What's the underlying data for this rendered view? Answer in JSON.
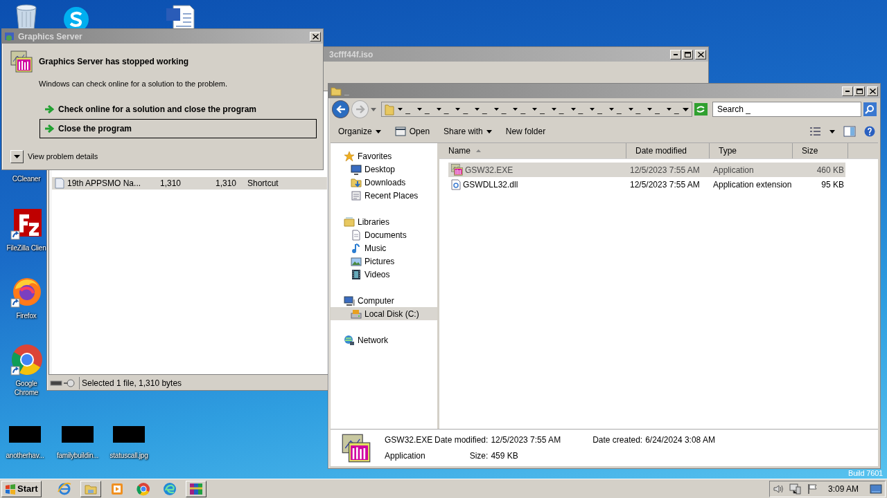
{
  "desktop": {
    "icons": [
      {
        "kind": "recycle-bin"
      },
      {
        "kind": "skype"
      },
      {
        "kind": "word"
      },
      {
        "kind": "ccleaner",
        "label": "CCleaner"
      },
      {
        "kind": "filezilla",
        "label": "FileZilla Clien"
      },
      {
        "kind": "firefox",
        "label": "Firefox"
      },
      {
        "kind": "chrome",
        "label": "Google Chrome"
      },
      {
        "kind": "thumbnail",
        "label": "anotherhav..."
      },
      {
        "kind": "thumbnail",
        "label": "familybuildin..."
      },
      {
        "kind": "thumbnail",
        "label": "statuscall.jpg"
      }
    ],
    "build": "Build 7601"
  },
  "back_window": {
    "title": "3cfff44f.iso",
    "rows": [
      {
        "cells": [
          "19th APPSMO Na...",
          "1,310",
          "1,310",
          "Shortcut"
        ],
        "selected": true
      }
    ],
    "status": "Selected 1 file, 1,310 bytes"
  },
  "error_dialog": {
    "title": "Graphics Server",
    "heading": "Graphics Server has stopped working",
    "message": "Windows can check online for a solution to the problem.",
    "options": [
      {
        "label": "Check online for a solution and close the program",
        "selected": false
      },
      {
        "label": "Close the program",
        "selected": true
      }
    ],
    "details": {
      "label": "View problem details",
      "expanded": false
    }
  },
  "explorer": {
    "title": "_",
    "address": {
      "segments": [
        "_",
        "_",
        "_",
        "_",
        "_",
        "_",
        "_",
        "_",
        "_",
        "_",
        "_",
        "_",
        "_",
        "_",
        "_"
      ]
    },
    "search": {
      "placeholder": "Search _"
    },
    "toolbar": [
      {
        "label": "Organize",
        "kind": "menu"
      },
      {
        "label": "Open",
        "kind": "open"
      },
      {
        "label": "Share with",
        "kind": "menu"
      },
      {
        "label": "New folder",
        "kind": "plain"
      }
    ],
    "nav": [
      {
        "label": "Favorites",
        "kind": "star",
        "selected": false,
        "children": [
          {
            "label": "Desktop",
            "kind": "desktop",
            "selected": false
          },
          {
            "label": "Downloads",
            "kind": "downloads",
            "selected": false
          },
          {
            "label": "Recent Places",
            "kind": "recent",
            "selected": false
          }
        ]
      },
      {
        "label": "Libraries",
        "kind": "libraries",
        "selected": false,
        "children": [
          {
            "label": "Documents",
            "kind": "documents",
            "selected": false
          },
          {
            "label": "Music",
            "kind": "music",
            "selected": false
          },
          {
            "label": "Pictures",
            "kind": "pictures",
            "selected": false
          },
          {
            "label": "Videos",
            "kind": "videos",
            "selected": false
          }
        ]
      },
      {
        "label": "Computer",
        "kind": "computer",
        "selected": false,
        "children": [
          {
            "label": "Local Disk (C:)",
            "kind": "disk",
            "selected": true
          }
        ]
      },
      {
        "label": "Network",
        "kind": "network",
        "selected": false
      }
    ],
    "columns": [
      {
        "label": "Name",
        "sorted": true
      },
      {
        "label": "Date modified",
        "sorted": false
      },
      {
        "label": "Type",
        "sorted": false
      },
      {
        "label": "Size",
        "sorted": false
      }
    ],
    "files": [
      {
        "name": "GSW32.EXE",
        "kind": "exe",
        "date": "12/5/2023 7:55 AM",
        "type": "Application",
        "size": "460 KB",
        "selected": true
      },
      {
        "name": "GSWDLL32.dll",
        "kind": "dll",
        "date": "12/5/2023 7:55 AM",
        "type": "Application extension",
        "size": "95 KB",
        "selected": false
      }
    ],
    "details": {
      "name": "GSW32.EXE",
      "type": "Application",
      "fields": [
        {
          "label": "Date modified:",
          "value": "12/5/2023 7:55 AM"
        },
        {
          "label": "Size:",
          "value": "459 KB"
        },
        {
          "label": "Date created:",
          "value": "6/24/2024 3:08 AM"
        }
      ]
    }
  },
  "taskbar": {
    "start": "Start",
    "apps": [
      {
        "kind": "ie",
        "active": false
      },
      {
        "kind": "explorer",
        "active": true
      },
      {
        "kind": "media",
        "active": false
      },
      {
        "kind": "chrome",
        "active": false
      },
      {
        "kind": "edge",
        "active": false
      },
      {
        "kind": "winrar",
        "active": true
      }
    ],
    "clock": "3:09 AM"
  }
}
